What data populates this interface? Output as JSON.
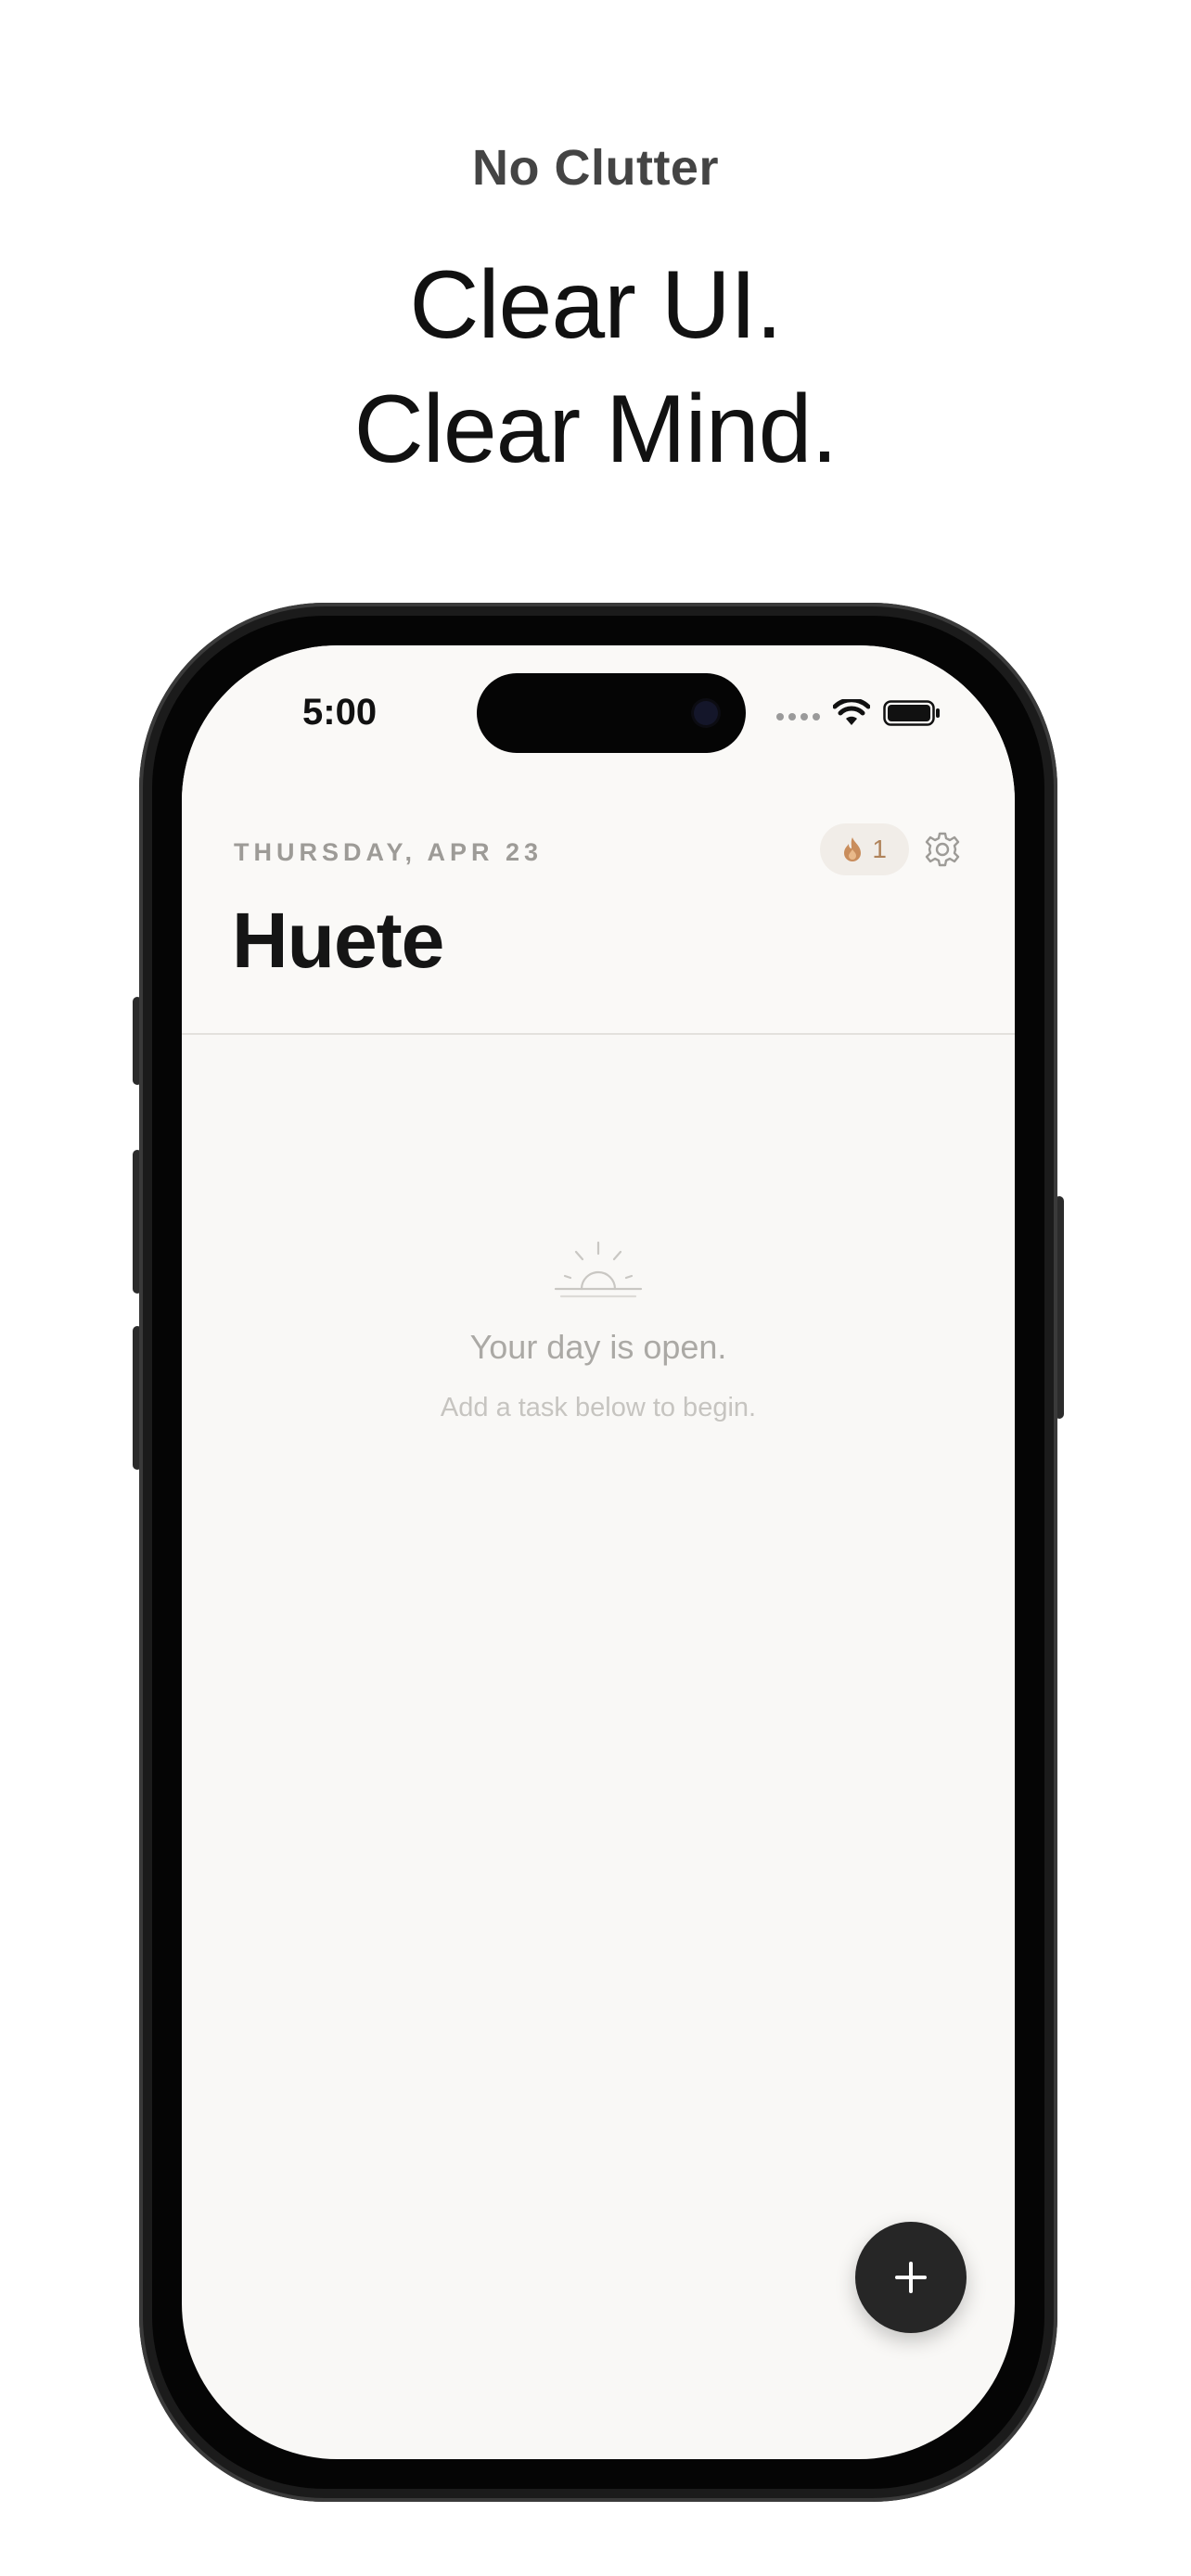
{
  "marketing": {
    "eyebrow": "No Clutter",
    "headline_line1": "Clear UI.",
    "headline_line2": "Clear Mind."
  },
  "status_bar": {
    "time": "5:00",
    "icons": [
      "cellular-signal-icon",
      "wifi-icon",
      "battery-icon"
    ]
  },
  "header": {
    "date": "THURSDAY, APR 23",
    "title": "Huete",
    "streak": {
      "icon": "flame-icon",
      "count": "1",
      "color": "#b0835a"
    },
    "settings_icon": "gear-icon"
  },
  "empty_state": {
    "icon": "sunrise-icon",
    "title": "Your day is open.",
    "subtitle": "Add a task below to begin."
  },
  "fab": {
    "icon": "plus-icon"
  },
  "colors": {
    "screen_background": "#f9f8f6",
    "accent_dark": "#262626",
    "muted_text": "#aba9a5",
    "streak_pill_bg": "#f1ede8"
  }
}
